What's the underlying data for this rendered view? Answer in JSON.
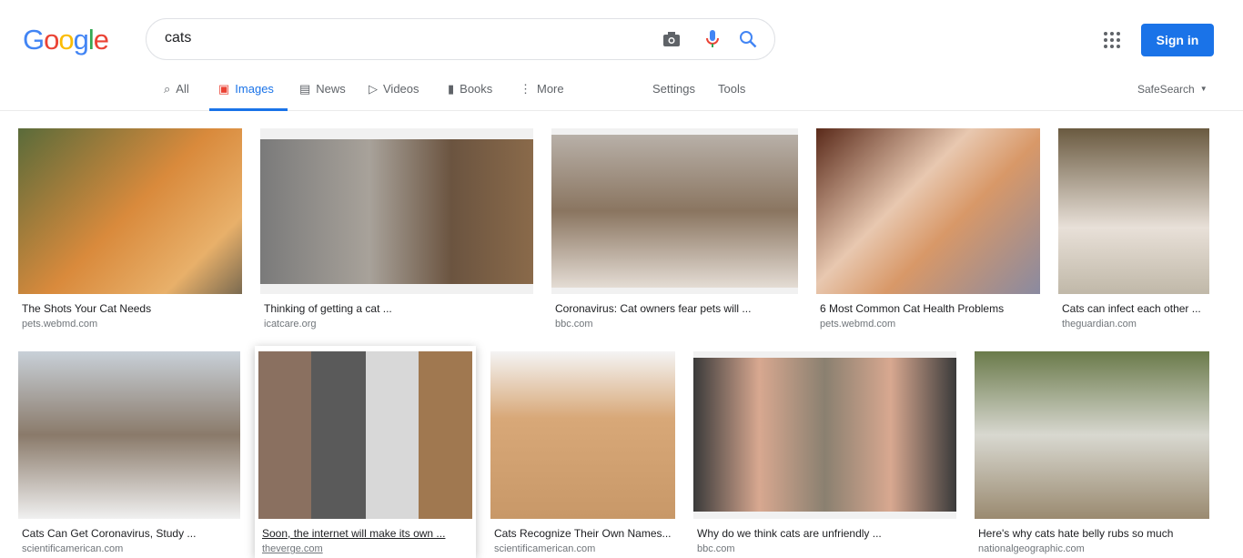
{
  "header": {
    "logo": "Google",
    "query": "cats",
    "signin": "Sign in"
  },
  "tabs": [
    {
      "label": "All"
    },
    {
      "label": "Images"
    },
    {
      "label": "News"
    },
    {
      "label": "Videos"
    },
    {
      "label": "Books"
    },
    {
      "label": "More"
    }
  ],
  "settings": "Settings",
  "tools": "Tools",
  "safesearch": "SafeSearch",
  "results": [
    {
      "title": "The Shots Your Cat Needs",
      "source": "pets.webmd.com"
    },
    {
      "title": "Thinking of getting a cat ...",
      "source": "icatcare.org"
    },
    {
      "title": "Coronavirus: Cat owners fear pets will ...",
      "source": "bbc.com"
    },
    {
      "title": "6 Most Common Cat Health Problems",
      "source": "pets.webmd.com"
    },
    {
      "title": "Cats can infect each other ...",
      "source": "theguardian.com"
    },
    {
      "title": "Cats Can Get Coronavirus, Study ...",
      "source": "scientificamerican.com"
    },
    {
      "title": "Soon, the internet will make its own ...",
      "source": "theverge.com"
    },
    {
      "title": "Cats Recognize Their Own Names...",
      "source": "scientificamerican.com"
    },
    {
      "title": "Why do we think cats are unfriendly ...",
      "source": "bbc.com"
    },
    {
      "title": "Here's why cats hate belly rubs so much",
      "source": "nationalgeographic.com"
    }
  ]
}
